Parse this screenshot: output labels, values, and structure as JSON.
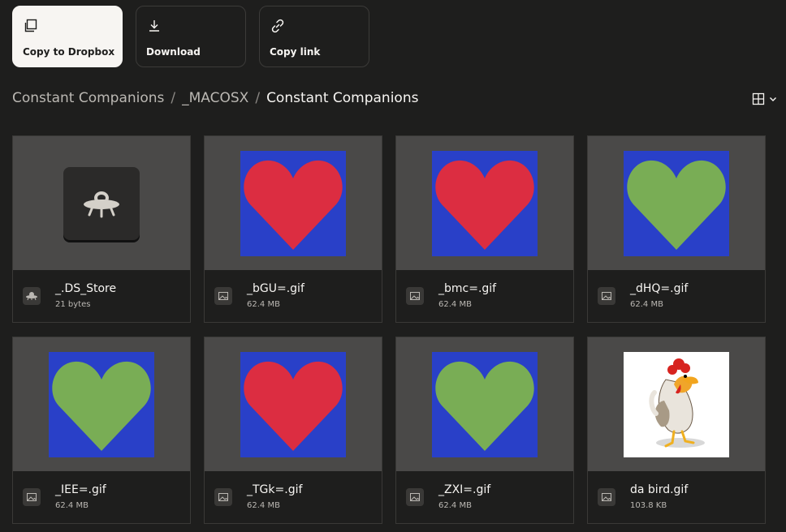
{
  "toolbar": {
    "copy_label": "Copy to Dropbox",
    "download_label": "Download",
    "link_label": "Copy link"
  },
  "breadcrumb": {
    "items": [
      "Constant Companions",
      "_MACOSX"
    ],
    "separator": "/",
    "current": "Constant Companions"
  },
  "files": [
    {
      "name": "_.DS_Store",
      "size": "21 bytes",
      "thumb": "ufo-app-icon"
    },
    {
      "name": "_bGU=.gif",
      "size": "62.4 MB",
      "thumb": "red-heart"
    },
    {
      "name": "_bmc=.gif",
      "size": "62.4 MB",
      "thumb": "red-heart"
    },
    {
      "name": "_dHQ=.gif",
      "size": "62.4 MB",
      "thumb": "green-heart"
    },
    {
      "name": "_IEE=.gif",
      "size": "62.4 MB",
      "thumb": "green-heart"
    },
    {
      "name": "_TGk=.gif",
      "size": "62.4 MB",
      "thumb": "red-heart"
    },
    {
      "name": "_ZXI=.gif",
      "size": "62.4 MB",
      "thumb": "green-heart"
    },
    {
      "name": "da bird.gif",
      "size": "103.8 KB",
      "thumb": "rooster"
    }
  ],
  "colors": {
    "background": "#1e1e1d",
    "heart_bg": "#2940c8",
    "heart_red": "#dc2d41",
    "heart_green": "#79ad55"
  }
}
